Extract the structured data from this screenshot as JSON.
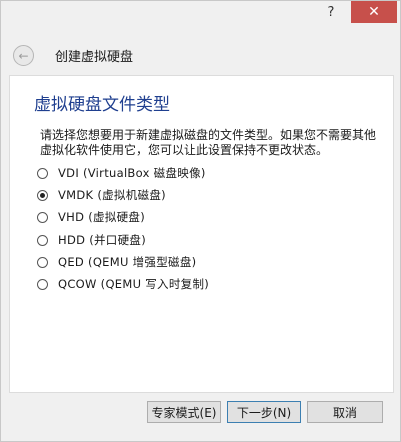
{
  "window": {
    "help_glyph": "?",
    "close_glyph": "✕",
    "close_color": "#c7504b"
  },
  "header": {
    "back_glyph": "←",
    "title": "创建虚拟硬盘"
  },
  "page": {
    "title": "虚拟硬盘文件类型",
    "description": "请选择您想要用于新建虚拟磁盘的文件类型。如果您不需要其他虚拟化软件使用它，您可以让此设置保持不更改状态。"
  },
  "options": [
    {
      "label": "VDI (VirtualBox 磁盘映像)",
      "checked": false
    },
    {
      "label": "VMDK (虚拟机磁盘)",
      "checked": true
    },
    {
      "label": "VHD (虚拟硬盘)",
      "checked": false
    },
    {
      "label": "HDD (并口硬盘)",
      "checked": false
    },
    {
      "label": "QED (QEMU 增强型磁盘)",
      "checked": false
    },
    {
      "label": "QCOW (QEMU 写入时复制)",
      "checked": false
    }
  ],
  "footer": {
    "expert_label": "专家模式(E)",
    "next_label": "下一步(N)",
    "cancel_label": "取消"
  }
}
